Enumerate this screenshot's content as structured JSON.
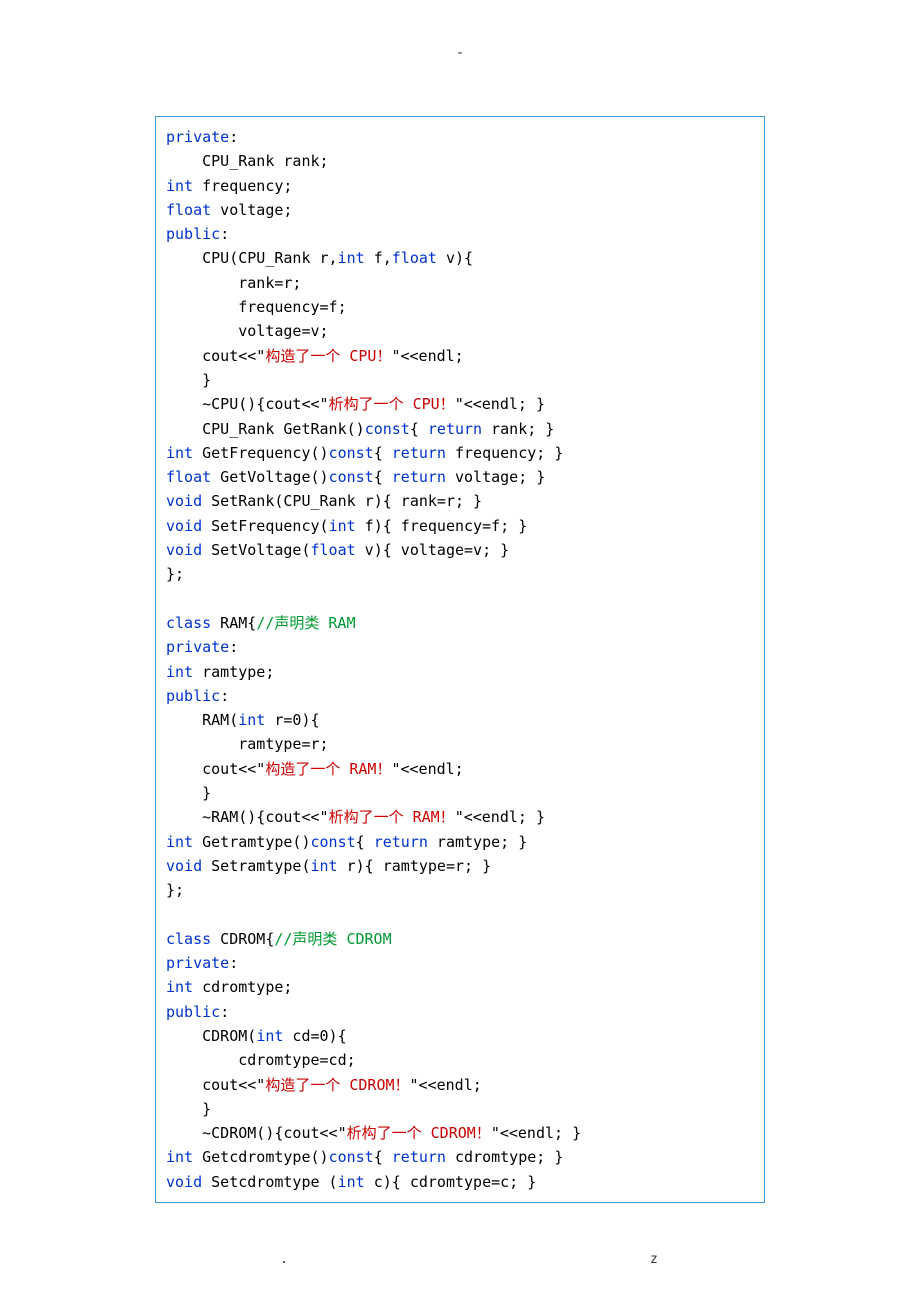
{
  "header": {
    "dash": "-"
  },
  "footer": {
    "dot": ".",
    "letter": "z"
  },
  "code": [
    [
      {
        "t": "private",
        "c": "k-blue"
      },
      {
        "t": ":"
      }
    ],
    [
      {
        "t": "    CPU_Rank rank;"
      }
    ],
    [
      {
        "t": "int",
        "c": "k-blue"
      },
      {
        "t": " frequency;"
      }
    ],
    [
      {
        "t": "float",
        "c": "k-blue"
      },
      {
        "t": " voltage;"
      }
    ],
    [
      {
        "t": "public",
        "c": "k-blue"
      },
      {
        "t": ":"
      }
    ],
    [
      {
        "t": "    CPU(CPU_Rank r,"
      },
      {
        "t": "int",
        "c": "k-blue"
      },
      {
        "t": " f,"
      },
      {
        "t": "float",
        "c": "k-blue"
      },
      {
        "t": " v){"
      }
    ],
    [
      {
        "t": "        rank=r;"
      }
    ],
    [
      {
        "t": "        frequency=f;"
      }
    ],
    [
      {
        "t": "        voltage=v;"
      }
    ],
    [
      {
        "t": "    cout<<\""
      },
      {
        "t": "构造了一个 CPU！",
        "c": "k-red"
      },
      {
        "t": "\"<<endl;"
      }
    ],
    [
      {
        "t": "    }"
      }
    ],
    [
      {
        "t": "    ~CPU(){cout<<\""
      },
      {
        "t": "析构了一个 CPU！",
        "c": "k-red"
      },
      {
        "t": "\"<<endl; }"
      }
    ],
    [
      {
        "t": "    CPU_Rank GetRank()"
      },
      {
        "t": "const",
        "c": "k-blue"
      },
      {
        "t": "{ "
      },
      {
        "t": "return",
        "c": "k-blue"
      },
      {
        "t": " rank; }"
      }
    ],
    [
      {
        "t": "int",
        "c": "k-blue"
      },
      {
        "t": " GetFrequency()"
      },
      {
        "t": "const",
        "c": "k-blue"
      },
      {
        "t": "{ "
      },
      {
        "t": "return",
        "c": "k-blue"
      },
      {
        "t": " frequency; }"
      }
    ],
    [
      {
        "t": "float",
        "c": "k-blue"
      },
      {
        "t": " GetVoltage()"
      },
      {
        "t": "const",
        "c": "k-blue"
      },
      {
        "t": "{ "
      },
      {
        "t": "return",
        "c": "k-blue"
      },
      {
        "t": " voltage; }"
      }
    ],
    [
      {
        "t": "void",
        "c": "k-blue"
      },
      {
        "t": " SetRank(CPU_Rank r){ rank=r; }"
      }
    ],
    [
      {
        "t": "void",
        "c": "k-blue"
      },
      {
        "t": " SetFrequency("
      },
      {
        "t": "int",
        "c": "k-blue"
      },
      {
        "t": " f){ frequency=f; }"
      }
    ],
    [
      {
        "t": "void",
        "c": "k-blue"
      },
      {
        "t": " SetVoltage("
      },
      {
        "t": "float",
        "c": "k-blue"
      },
      {
        "t": " v){ voltage=v; }"
      }
    ],
    [
      {
        "t": "};"
      }
    ],
    [
      {
        "t": " "
      }
    ],
    [
      {
        "t": "class",
        "c": "k-blue"
      },
      {
        "t": " RAM{"
      },
      {
        "t": "//声明类 RAM",
        "c": "k-green"
      }
    ],
    [
      {
        "t": "private",
        "c": "k-blue"
      },
      {
        "t": ":"
      }
    ],
    [
      {
        "t": "int",
        "c": "k-blue"
      },
      {
        "t": " ramtype;"
      }
    ],
    [
      {
        "t": "public",
        "c": "k-blue"
      },
      {
        "t": ":"
      }
    ],
    [
      {
        "t": "    RAM("
      },
      {
        "t": "int",
        "c": "k-blue"
      },
      {
        "t": " r=0){"
      }
    ],
    [
      {
        "t": "        ramtype=r;"
      }
    ],
    [
      {
        "t": "    cout<<\""
      },
      {
        "t": "构造了一个 RAM！",
        "c": "k-red"
      },
      {
        "t": "\"<<endl;"
      }
    ],
    [
      {
        "t": "    }"
      }
    ],
    [
      {
        "t": "    ~RAM(){cout<<\""
      },
      {
        "t": "析构了一个 RAM！",
        "c": "k-red"
      },
      {
        "t": "\"<<endl; }"
      }
    ],
    [
      {
        "t": "int",
        "c": "k-blue"
      },
      {
        "t": " Getramtype()"
      },
      {
        "t": "const",
        "c": "k-blue"
      },
      {
        "t": "{ "
      },
      {
        "t": "return",
        "c": "k-blue"
      },
      {
        "t": " ramtype; }"
      }
    ],
    [
      {
        "t": "void",
        "c": "k-blue"
      },
      {
        "t": " Setramtype("
      },
      {
        "t": "int",
        "c": "k-blue"
      },
      {
        "t": " r){ ramtype=r; }"
      }
    ],
    [
      {
        "t": "};"
      }
    ],
    [
      {
        "t": " "
      }
    ],
    [
      {
        "t": "class",
        "c": "k-blue"
      },
      {
        "t": " CDROM{"
      },
      {
        "t": "//声明类 CDROM",
        "c": "k-green"
      }
    ],
    [
      {
        "t": "private",
        "c": "k-blue"
      },
      {
        "t": ":"
      }
    ],
    [
      {
        "t": "int",
        "c": "k-blue"
      },
      {
        "t": " cdromtype;"
      }
    ],
    [
      {
        "t": "public",
        "c": "k-blue"
      },
      {
        "t": ":"
      }
    ],
    [
      {
        "t": "    CDROM("
      },
      {
        "t": "int",
        "c": "k-blue"
      },
      {
        "t": " cd=0){"
      }
    ],
    [
      {
        "t": "        cdromtype=cd;"
      }
    ],
    [
      {
        "t": "    cout<<\""
      },
      {
        "t": "构造了一个 CDROM！",
        "c": "k-red"
      },
      {
        "t": "\"<<endl;"
      }
    ],
    [
      {
        "t": "    }"
      }
    ],
    [
      {
        "t": "    ~CDROM(){cout<<\""
      },
      {
        "t": "析构了一个 CDROM！",
        "c": "k-red"
      },
      {
        "t": "\"<<endl; }"
      }
    ],
    [
      {
        "t": "int",
        "c": "k-blue"
      },
      {
        "t": " Getcdromtype()"
      },
      {
        "t": "const",
        "c": "k-blue"
      },
      {
        "t": "{ "
      },
      {
        "t": "return",
        "c": "k-blue"
      },
      {
        "t": " cdromtype; }"
      }
    ],
    [
      {
        "t": "void",
        "c": "k-blue"
      },
      {
        "t": " Setcdromtype ("
      },
      {
        "t": "int",
        "c": "k-blue"
      },
      {
        "t": " c){ cdromtype=c; }"
      }
    ]
  ]
}
